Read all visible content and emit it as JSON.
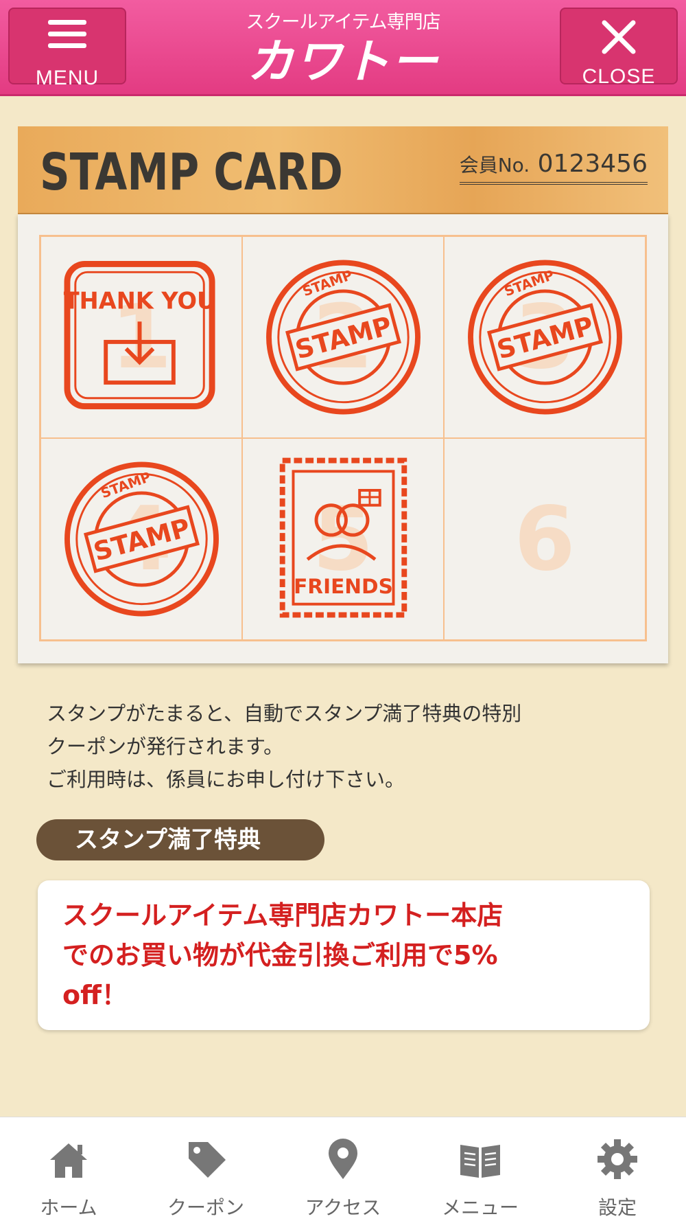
{
  "header": {
    "menu_label": "MENU",
    "close_label": "CLOSE",
    "brand_sub": "スクールアイテム専門店",
    "brand_main": "カワトー"
  },
  "card": {
    "title": "STAMP CARD",
    "member_label": "会員No.",
    "member_number": "0123456",
    "cells": [
      {
        "number": "1",
        "stamp_text": "THANK YOU",
        "stamped": true
      },
      {
        "number": "2",
        "stamp_text": "STAMP",
        "ring_text": "STAMP",
        "stamped": true
      },
      {
        "number": "3",
        "stamp_text": "STAMP",
        "ring_text": "STAMP",
        "stamped": true
      },
      {
        "number": "4",
        "stamp_text": "STAMP",
        "ring_text": "STAMP",
        "stamped": true
      },
      {
        "number": "5",
        "stamp_text": "FRIENDS",
        "stamped": true
      },
      {
        "number": "6",
        "stamped": false
      }
    ]
  },
  "info": {
    "line1": "スタンプがたまると、自動でスタンプ満了特典の特別",
    "line2": "クーポンが発行されます。",
    "line3": "ご利用時は、係員にお申し付け下さい。"
  },
  "reward": {
    "heading": "スタンプ満了特典",
    "line1": "スクールアイテム専門店カワトー本店",
    "line2": "でのお買い物が代金引換ご利用で5%",
    "line3": "off！"
  },
  "tabs": [
    {
      "label": "ホーム",
      "icon": "home-icon"
    },
    {
      "label": "クーポン",
      "icon": "tag-icon"
    },
    {
      "label": "アクセス",
      "icon": "map-pin-icon"
    },
    {
      "label": "メニュー",
      "icon": "book-icon"
    },
    {
      "label": "設定",
      "icon": "gear-icon"
    }
  ],
  "colors": {
    "header": "#e8478c",
    "stamp": "#e8471e",
    "reward_text": "#d42020",
    "pill": "#6b5238"
  }
}
